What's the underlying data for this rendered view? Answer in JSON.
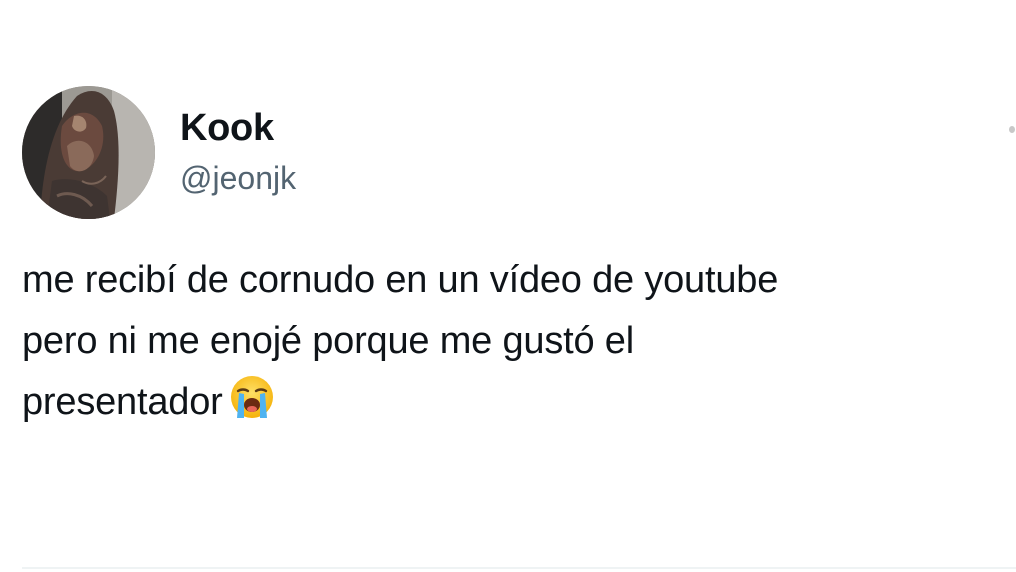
{
  "tweet": {
    "author": {
      "display_name": "Kook",
      "handle": "@jeonjk",
      "avatar_icon": "profile-photo"
    },
    "text_lines": [
      "me recibí de cornudo en un vídeo de youtube",
      "pero ni me enojé porque me gustó el",
      "presentador"
    ],
    "emoji": "loudly-crying-face-emoji",
    "more_icon": "more-options-icon"
  },
  "colors": {
    "text_primary": "#0f1419",
    "text_secondary": "#536471",
    "background": "#ffffff",
    "divider": "#eff3f4"
  }
}
